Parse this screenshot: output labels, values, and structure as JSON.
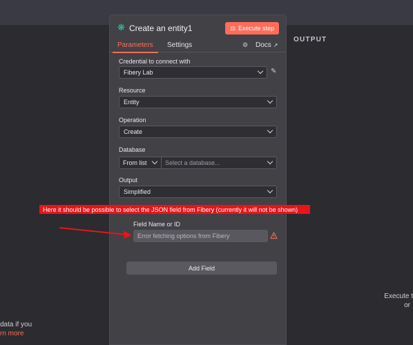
{
  "background": {
    "output_label": "OUTPUT",
    "left_hint_line1": "data if you",
    "left_hint_link": "rn more",
    "right_hint_line1": "Execute t",
    "right_hint_line2": "or"
  },
  "node": {
    "title": "Create an entity1",
    "execute_label": "Execute step",
    "icon": "fibery-logo-icon",
    "accent_color": "#ff6d5a"
  },
  "tabs": {
    "parameters": "Parameters",
    "settings": "Settings",
    "docs": "Docs"
  },
  "fields": {
    "credential_label": "Credential to connect with",
    "credential_value": "Fibery Lab",
    "resource_label": "Resource",
    "resource_value": "Entity",
    "operation_label": "Operation",
    "operation_value": "Create",
    "database_label": "Database",
    "database_mode": "From list",
    "database_placeholder": "Select a database...",
    "output_label": "Output",
    "output_value": "Simplified",
    "field_name_label": "Field Name or ID",
    "field_name_value": "Error fetching options from Fibery",
    "add_field_label": "Add Field"
  },
  "annotation": {
    "text": "Here it should be possible to select the JSON field from Fibery (currently it will not be shown)",
    "color": "#e8141a"
  }
}
